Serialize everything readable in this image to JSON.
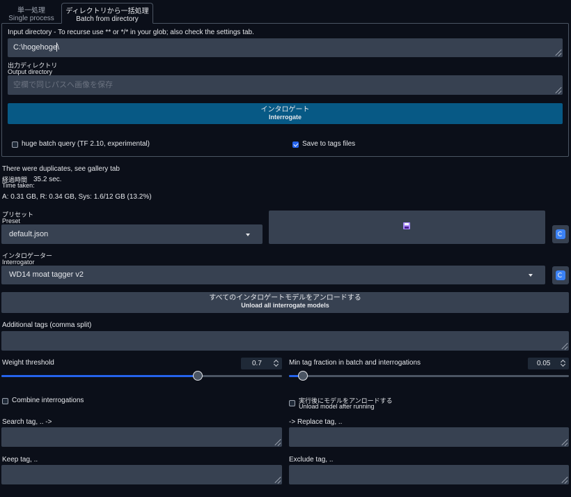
{
  "tabs": [
    {
      "ja": "単一処理",
      "en": "Single process"
    },
    {
      "ja": "ディレクトリから一括処理",
      "en": "Batch from directory"
    }
  ],
  "input_directory": {
    "label": "Input directory - To recurse use ** or */* in your glob; also check the settings tab.",
    "value": "C:\\hogehoge\\"
  },
  "output_directory": {
    "label_ja": "出力ディレクトリ",
    "label_en": "Output directory",
    "placeholder": "空欄で同じパスへ画像を保存"
  },
  "interrogate_button": {
    "ja": "インタロゲート",
    "en": "Interrogate"
  },
  "huge_batch": {
    "label": "huge batch query (TF 2.10, experimental)",
    "checked": false
  },
  "save_tags": {
    "label": "Save to tags files",
    "checked": true
  },
  "status": {
    "message": "There were duplicates, see gallery tab",
    "time_label_ja": "経過時間",
    "time_value": "35.2 sec.",
    "time_label_en": "Time taken:",
    "memory": "A: 0.31 GB, R: 0.34 GB, Sys: 1.6/12 GB (13.2%)"
  },
  "preset": {
    "label_ja": "プリセット",
    "label_en": "Preset",
    "value": "default.json",
    "save_icon": "floppy-disk-icon"
  },
  "interrogator": {
    "label_ja": "インタロゲーター",
    "label_en": "Interrogator",
    "value": "WD14 moat tagger v2"
  },
  "unload_all_button": {
    "ja": "すべてのインタロゲートモデルをアンロードする",
    "en": "Unload all interrogate models"
  },
  "additional_tags": {
    "label": "Additional tags (comma split)",
    "value": ""
  },
  "weight_threshold": {
    "label": "Weight threshold",
    "value": "0.7",
    "fraction": 0.7
  },
  "min_tag_fraction": {
    "label": "Min tag fraction in batch and interrogations",
    "value": "0.05",
    "fraction": 0.05
  },
  "combine_interrogations": {
    "label": "Combine interrogations",
    "checked": false
  },
  "unload_after": {
    "label_ja": "実行後にモデルをアンロードする",
    "label_en": "Unload model after running",
    "checked": false
  },
  "search_tag": {
    "label": "Search tag, .. ->"
  },
  "replace_tag": {
    "label": "-> Replace tag, .."
  },
  "keep_tag": {
    "label": "Keep tag, .."
  },
  "exclude_tag": {
    "label": "Exclude tag, .."
  },
  "colors": {
    "accent": "#2563eb",
    "primary_button": "#075985",
    "background": "#0b0f19",
    "field": "#374151"
  }
}
